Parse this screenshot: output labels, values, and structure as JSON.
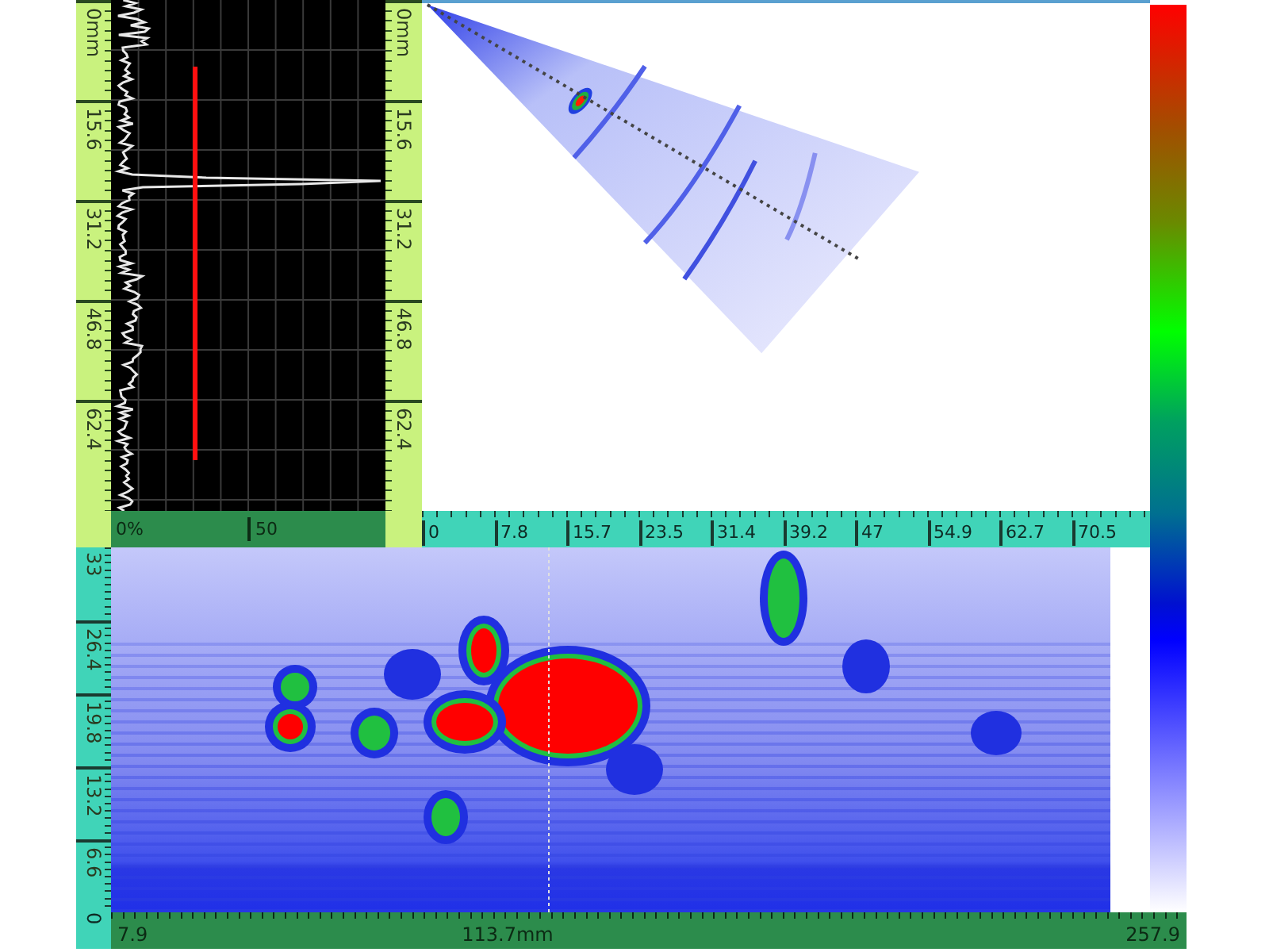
{
  "a_scan": {
    "depth_ruler_left": {
      "labels": [
        "0mm",
        "15.6",
        "31.2",
        "46.8",
        "62.4"
      ]
    },
    "depth_ruler_right": {
      "labels": [
        "0mm",
        "15.6",
        "31.2",
        "46.8",
        "62.4"
      ]
    },
    "amplitude_ruler": {
      "labels": [
        "0%",
        "50"
      ]
    }
  },
  "s_scan": {
    "index_ruler": {
      "labels": [
        "0",
        "7.8",
        "15.7",
        "23.5",
        "31.4",
        "39.2",
        "47",
        "54.9",
        "62.7",
        "70.5"
      ]
    }
  },
  "c_scan": {
    "depth_ruler": {
      "labels": [
        "33",
        "26.4",
        "19.8",
        "13.2",
        "6.6"
      ]
    },
    "corner_label": "0",
    "scan_ruler": {
      "labels": [
        "7.9",
        "113.7mm",
        "257.9"
      ]
    }
  }
}
